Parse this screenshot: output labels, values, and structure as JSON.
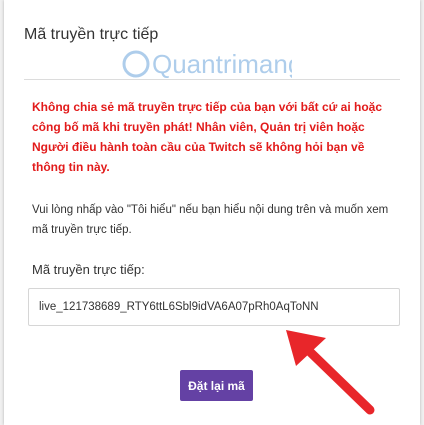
{
  "dialog": {
    "title": "Mã truyền trực tiếp",
    "warning": "Không chia sẻ mã truyền trực tiếp của bạn với bất cứ ai hoặc công bố mã khi truyền phát! Nhân viên, Quản trị viên hoặc Người điều hành toàn cầu của Twitch sẽ không hỏi bạn về thông tin này.",
    "info": "Vui lòng nhấp vào \"Tôi hiểu\" nếu bạn hiểu nội dung trên và muốn xem mã truyền trực tiếp.",
    "key_label": "Mã truyền trực tiếp:",
    "key_value": "live_121738689_RTY6ttL6Sbl9idVA6A07pRh0AqToNN",
    "reset_label": "Đặt lại mã"
  },
  "watermark": {
    "text": "Quantrimang"
  },
  "colors": {
    "warning": "#e21b1b",
    "button": "#6441a4",
    "arrow": "#e8262a"
  }
}
